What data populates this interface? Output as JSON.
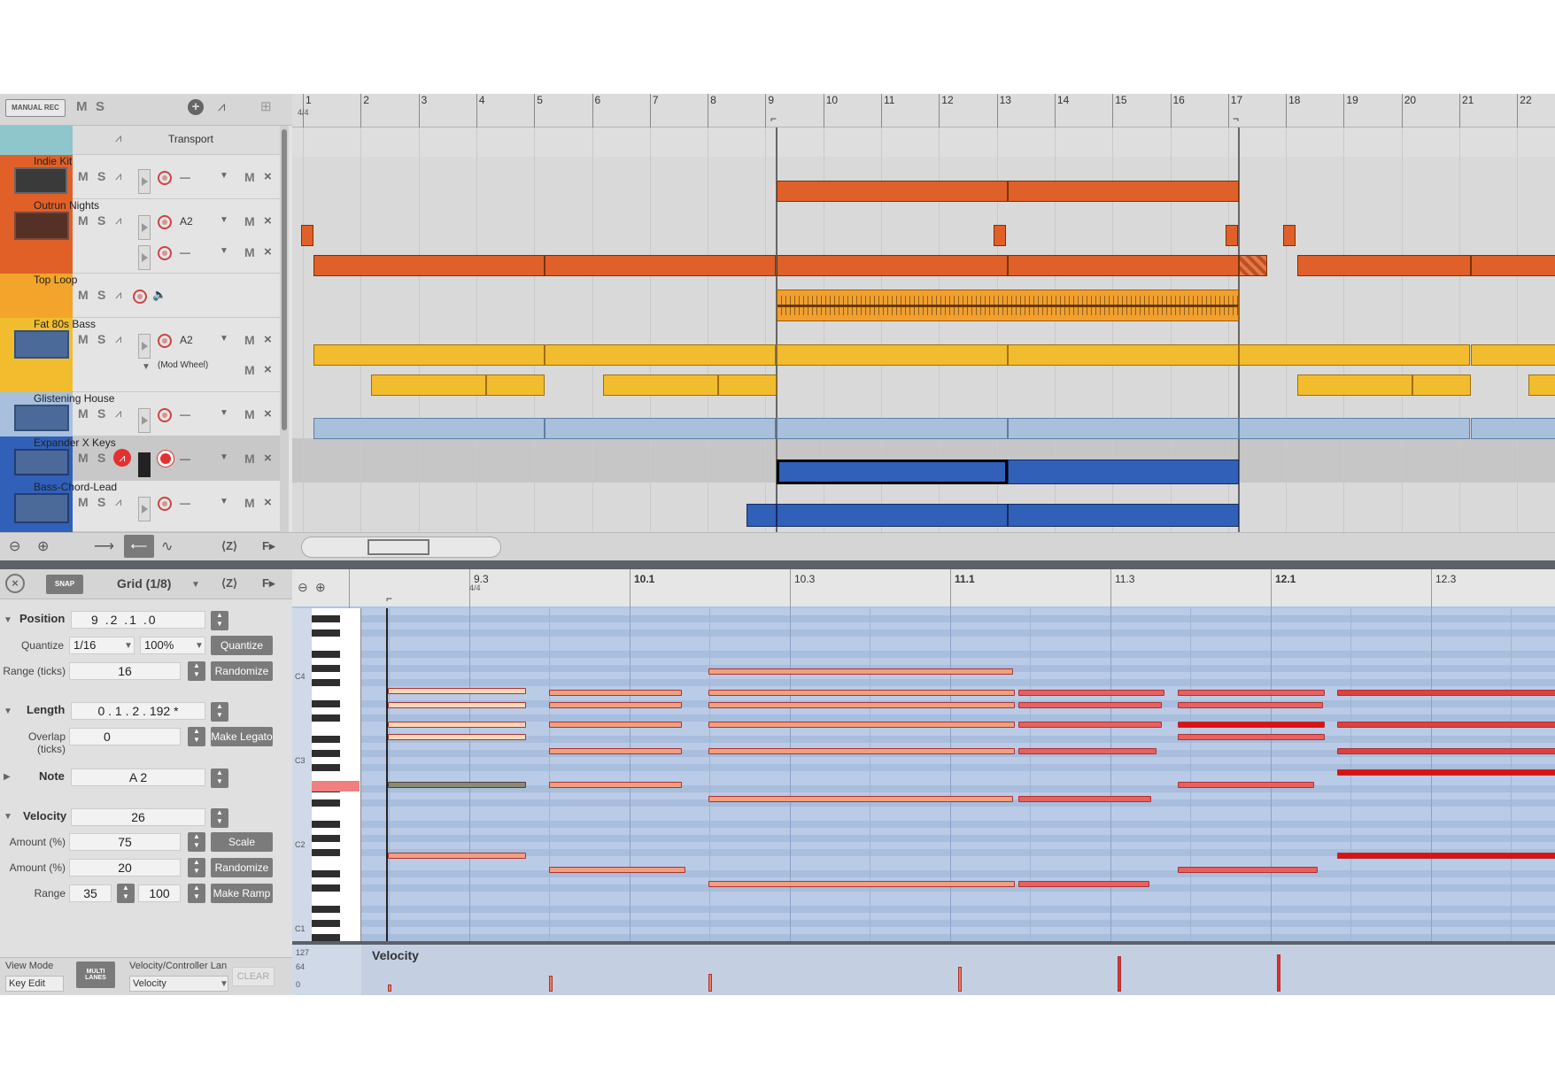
{
  "toolbar": {
    "manual_rec": "MANUAL REC",
    "m": "M",
    "s": "S"
  },
  "tracks": [
    {
      "name": "Transport"
    },
    {
      "name": "Indie Kit",
      "key": "—"
    },
    {
      "name": "Outrun Nights",
      "key": "A2",
      "key2": "—"
    },
    {
      "name": "Top Loop"
    },
    {
      "name": "Fat 80s Bass",
      "key": "A2",
      "lane": "(Mod Wheel)"
    },
    {
      "name": "Glistening House",
      "key": "—"
    },
    {
      "name": "Expander X Keys",
      "key": "—"
    },
    {
      "name": "Bass-Chord-Lead",
      "key": "—"
    }
  ],
  "labels": {
    "m": "M",
    "s": "S",
    "x": "×"
  },
  "ruler": {
    "bars": [
      "1",
      "2",
      "3",
      "4",
      "5",
      "6",
      "7",
      "8",
      "9",
      "10",
      "11",
      "12",
      "13",
      "14",
      "15",
      "16",
      "17",
      "18",
      "19",
      "20",
      "21",
      "22"
    ],
    "time_sig": "4/4"
  },
  "arrange_bottom": {
    "zoom_label": "Z",
    "follow_label": "F"
  },
  "piano_toolbar": {
    "snap": "SNAP",
    "grid": "Grid (1/8)",
    "zoom_label": "Z",
    "follow_label": "F"
  },
  "piano_ruler": {
    "marks": [
      "9.3",
      "10.1",
      "10.3",
      "11.1",
      "11.3",
      "12.1",
      "12.3"
    ],
    "time_sig": "4/4"
  },
  "octaves": [
    "C4",
    "C3",
    "C2",
    "C1"
  ],
  "inspector": {
    "position_label": "Position",
    "position": [
      "9",
      ".2",
      ".1",
      ".0"
    ],
    "quantize_label": "Quantize",
    "quantize_value": "1/16",
    "quantize_pct": "100%",
    "quantize_btn": "Quantize",
    "range_ticks_label": "Range (ticks)",
    "range_ticks": "16",
    "randomize_btn": "Randomize",
    "length_label": "Length",
    "length": "0 . 1 . 2 . 192 *",
    "overlap_label": "Overlap (ticks)",
    "overlap": "0",
    "legato_btn": "Make Legato",
    "note_label": "Note",
    "note": "A 2",
    "velocity_label": "Velocity",
    "velocity": "26",
    "amount_label": "Amount (%)",
    "amount1": "75",
    "scale_btn": "Scale",
    "amount2": "20",
    "randomize2_btn": "Randomize",
    "range_label": "Range",
    "range_lo": "35",
    "range_hi": "100",
    "ramp_btn": "Make Ramp"
  },
  "velocity_lane": {
    "title": "Velocity",
    "scale": [
      "127",
      "64",
      "0"
    ]
  },
  "view_mode": {
    "label": "View Mode",
    "value": "Key Edit",
    "multi": "MULTI LANES",
    "lane_label": "Velocity/Controller Lan",
    "lane_value": "Velocity",
    "clear": "CLEAR"
  }
}
